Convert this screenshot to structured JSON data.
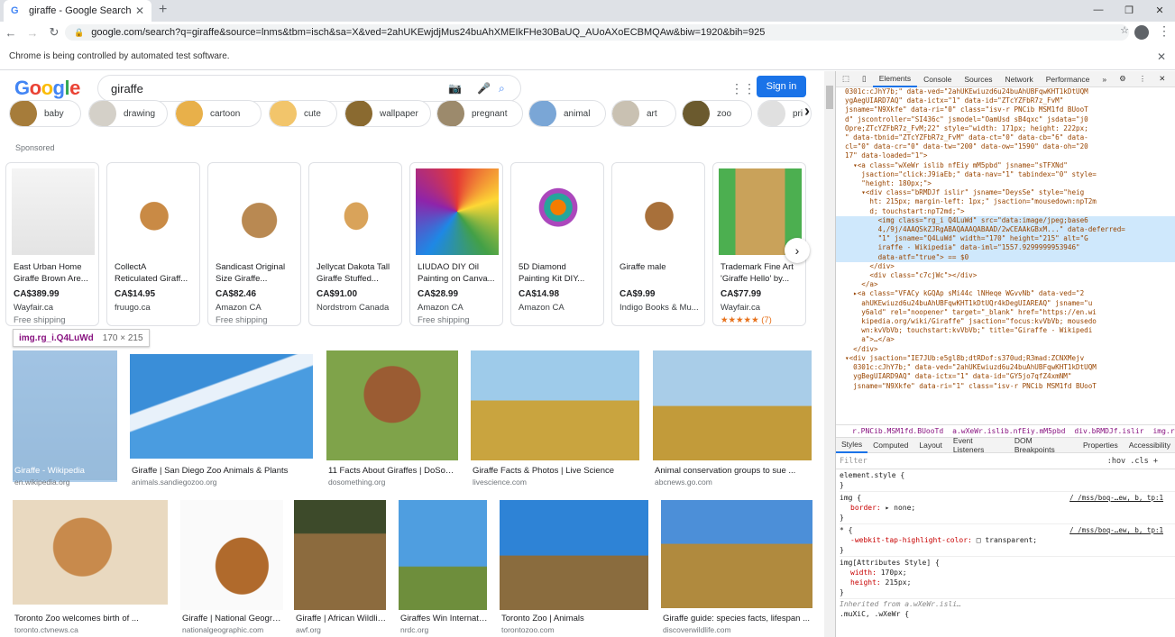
{
  "browser": {
    "tab_title": "giraffe - Google Search",
    "url": "google.com/search?q=giraffe&source=lnms&tbm=isch&sa=X&ved=2ahUKEwjdjMus24buAhXMEIkFHe30BaUQ_AUoAXoECBMQAw&biw=1920&bih=925",
    "infobar": "Chrome is being controlled by automated test software."
  },
  "google": {
    "logo": [
      "G",
      "o",
      "o",
      "g",
      "l",
      "e"
    ],
    "query": "giraffe",
    "signin": "Sign in",
    "sponsored": "Sponsored"
  },
  "chips": [
    "baby",
    "drawing",
    "cartoon",
    "cute",
    "wallpaper",
    "pregnant",
    "animal",
    "art",
    "zoo",
    "pri"
  ],
  "products": [
    {
      "t1": "East Urban Home",
      "t2": "Giraffe Brown Are...",
      "price": "CA$389.99",
      "store": "Wayfair.ca",
      "ship": "Free shipping"
    },
    {
      "t1": "CollectA",
      "t2": "Reticulated Giraff...",
      "price": "CA$14.95",
      "store": "fruugo.ca",
      "ship": ""
    },
    {
      "t1": "Sandicast Original",
      "t2": "Size Giraffe...",
      "price": "CA$82.46",
      "store": "Amazon CA",
      "ship": "Free shipping"
    },
    {
      "t1": "Jellycat Dakota Tall",
      "t2": "Giraffe Stuffed...",
      "price": "CA$91.00",
      "store": "Nordstrom Canada",
      "ship": ""
    },
    {
      "t1": "LIUDAO DIY Oil",
      "t2": "Painting on Canva...",
      "price": "CA$28.99",
      "store": "Amazon CA",
      "ship": "Free shipping"
    },
    {
      "t1": "5D Diamond",
      "t2": "Painting Kit DIY...",
      "price": "CA$14.98",
      "store": "Amazon CA",
      "ship": ""
    },
    {
      "t1": "Giraffe male",
      "t2": "",
      "price": "CA$9.99",
      "store": "Indigo Books & Mu...",
      "ship": ""
    },
    {
      "t1": "Trademark Fine Art",
      "t2": "'Giraffe Hello' by...",
      "price": "CA$77.99",
      "store": "Wayfair.ca",
      "ship": "★★★★★ (7)"
    }
  ],
  "tooltip": {
    "name": "img.rg_i.Q4LuWd",
    "dims": "170 × 215"
  },
  "row1": [
    {
      "title": "Giraffe - Wikipedia",
      "src": "en.wikipedia.org"
    },
    {
      "title": "Giraffe | San Diego Zoo Animals & Plants",
      "src": "animals.sandiegozoo.org"
    },
    {
      "title": "11 Facts About Giraffes | DoSometh...",
      "src": "dosomething.org"
    },
    {
      "title": "Giraffe Facts & Photos | Live Science",
      "src": "livescience.com"
    },
    {
      "title": "Animal conservation groups to sue ...",
      "src": "abcnews.go.com"
    }
  ],
  "row2": [
    {
      "title": "Toronto Zoo welcomes birth of ...",
      "src": "toronto.ctvnews.ca"
    },
    {
      "title": "Giraffe | National Geograph...",
      "src": "nationalgeographic.com"
    },
    {
      "title": "Giraffe | African Wildlife...",
      "src": "awf.org"
    },
    {
      "title": "Giraffes Win Internatio...",
      "src": "nrdc.org"
    },
    {
      "title": "Toronto Zoo | Animals",
      "src": "torontozoo.com"
    },
    {
      "title": "Giraffe guide: species facts, lifespan ...",
      "src": "discoverwildlife.com"
    }
  ],
  "devtools": {
    "tabs": [
      "Elements",
      "Console",
      "Sources",
      "Network",
      "Performance",
      "»"
    ],
    "dom_lines": [
      "0301c:cJhY7b;\" data-ved=\"2ahUKEwiuzd6u24buAhUBFqwKHT1kDtUQM",
      "ygAegUIARD7AQ\" data-ictx=\"1\" data-id=\"ZTcYZFbR7z_FvM\"",
      "jsname=\"N9Xkfe\" data-ri=\"0\" class=\"isv-r PNCib MSM1fd BUooT",
      "d\" jscontroller=\"SI436c\" jsmodel=\"OamUsd sB4qxc\" jsdata=\"j0",
      "Opre;ZTcYZFbR7z_FvM;22\" style=\"width: 171px; height: 222px;",
      "\" data-tbnid=\"ZTcYZFbR7z_FvM\" data-ct=\"0\" data-cb=\"6\" data-",
      "cl=\"0\" data-cr=\"0\" data-tw=\"200\" data-ow=\"1590\" data-oh=\"20",
      "17\" data-loaded=\"1\">",
      "  ▾<a class=\"wXeWr islib nfEiy mM5pbd\" jsname=\"sTFXNd\"",
      "    jsaction=\"click:J9iaEb;\" data-nav=\"1\" tabindex=\"0\" style=",
      "    \"height: 180px;\">",
      "    ▾<div class=\"bRMDJf islir\" jsname=\"DeysSe\" style=\"heig",
      "      ht: 215px; margin-left: 1px;\" jsaction=\"mousedown:npT2m",
      "      d; touchstart:npT2md;\">",
      "        <img class=\"rg_i Q4LuWd\" src=\"data:image/jpeg;base6",
      "        4,/9j/4AAQSkZJRgABAQAAAQABAAD/2wCEAAkGBxM...\" data-deferred=",
      "        \"1\" jsname=\"Q4LuWd\" width=\"170\" height=\"215\" alt=\"G",
      "        iraffe - Wikipedia\" data-iml=\"1557.9299999953946\"",
      "        data-atf=\"true\"> == $0",
      "      </div>",
      "      <div class=\"c7cjWc\"></div>",
      "    </a>",
      "  ▸<a class=\"VFACy kGQAp sMi44c lNHeqe WGvvNb\" data-ved=\"2",
      "    ahUKEwiuzd6u24buAhUBFqwKHT1kDtUQr4kDegUIAREAQ\" jsname=\"u",
      "    y6ald\" rel=\"noopener\" target=\"_blank\" href=\"https://en.wi",
      "    kipedia.org/wiki/Giraffe\" jsaction=\"focus:kvVbVb; mousedo",
      "    wn:kvVbVb; touchstart:kvVbVb;\" title=\"Giraffe - Wikipedi",
      "    a\">…</a>",
      "  </div>",
      "▾<div jsaction=\"IE7JUb:e5gl8b;dtRDof:s370ud;R3mad:ZCNXMejv",
      "  0301c:cJhY7b;\" data-ved=\"2ahUKEwiuzd6u24buAhUBFqwKHT1kDtUQM",
      "  ygBegUIARD9AQ\" data-ictx=\"1\" data-id=\"GY5jo7qfZ4xmNM\"",
      "  jsname=\"N9Xkfe\" data-ri=\"1\" class=\"isv-r PNCib MSM1fd BUooT"
    ],
    "breadcrumb": [
      "r.PNCib.MSM1fd.BUooTd",
      "a.wXeWr.islib.nfEiy.mM5pbd",
      "div.bRMDJf.islir",
      "img.rg_i.Q4LuWd"
    ],
    "style_tabs": [
      "Styles",
      "Computed",
      "Layout",
      "Event Listeners",
      "DOM Breakpoints",
      "Properties",
      "Accessibility"
    ],
    "filter": "Filter",
    "filter_right": ":hov  .cls  +",
    "rules": [
      {
        "selector": "element.style {",
        "props": [],
        "src": ""
      },
      {
        "selector": "img {",
        "props": [
          [
            "border",
            "▸ none;"
          ]
        ],
        "src": "/_/mss/boq-…ew, b, tp:1"
      },
      {
        "selector": "* {",
        "props": [
          [
            "-webkit-tap-highlight-color",
            "□ transparent;"
          ]
        ],
        "src": "/_/mss/boq-…ew, b, tp:1"
      },
      {
        "selector": "img[Attributes Style] {",
        "props": [
          [
            "width",
            "170px;"
          ],
          [
            "height",
            "215px;"
          ]
        ],
        "src": ""
      }
    ],
    "inherited": "Inherited from a.wXeWr.isli…",
    "last_selector": ".muXiC, .wXeWr {"
  }
}
